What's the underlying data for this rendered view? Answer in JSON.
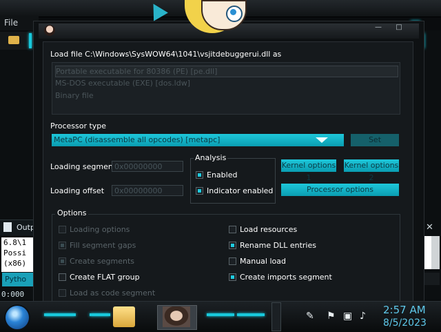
{
  "background": {
    "menu_file": "File",
    "output_label": "Outp",
    "output_lines": "6.8\\1\nPossi\n(x86)",
    "python_label": "Pytho",
    "status_text": "0:000"
  },
  "dialog": {
    "load_file_label": "Load file C:\\Windows\\SysWOW64\\1041\\vsjitdebuggerui.dll as",
    "formats": [
      "Portable executable for 80386 (PE) [pe.dll]",
      "MS-DOS executable (EXE) [dos.ldw]",
      "Binary file"
    ],
    "processor_type_label": "Processor type",
    "processor_selected": "MetaPC (disassemble all opcodes) [metapc]",
    "set_button": "Set",
    "loading_segment_label": "Loading segment",
    "loading_segment_value": "0x00000000",
    "loading_offset_label": "Loading offset",
    "loading_offset_value": "0x00000000",
    "analysis": {
      "legend": "Analysis",
      "enabled_label": "Enabled",
      "enabled": true,
      "indicator_label": "Indicator enabled",
      "indicator": true
    },
    "kernel_options_1": "Kernel options 1",
    "kernel_options_2": "Kernel options 2",
    "processor_options": "Processor options",
    "options": {
      "legend": "Options",
      "loading_options": "Loading options",
      "fill_segment_gaps": "Fill segment gaps",
      "create_segments": "Create segments",
      "create_flat_group": "Create FLAT group",
      "load_as_code_segment": "Load as code segment",
      "load_resources": "Load resources",
      "rename_dll_entries": "Rename DLL entries",
      "manual_load": "Manual load",
      "create_imports_segment": "Create imports segment"
    }
  },
  "taskbar": {
    "time": "2:57 AM",
    "date": "8/5/2023"
  },
  "colors": {
    "accent_cyan": "#1ec7da",
    "clock_blue": "#5ec8ea",
    "dialog_bg": "#15191c"
  }
}
